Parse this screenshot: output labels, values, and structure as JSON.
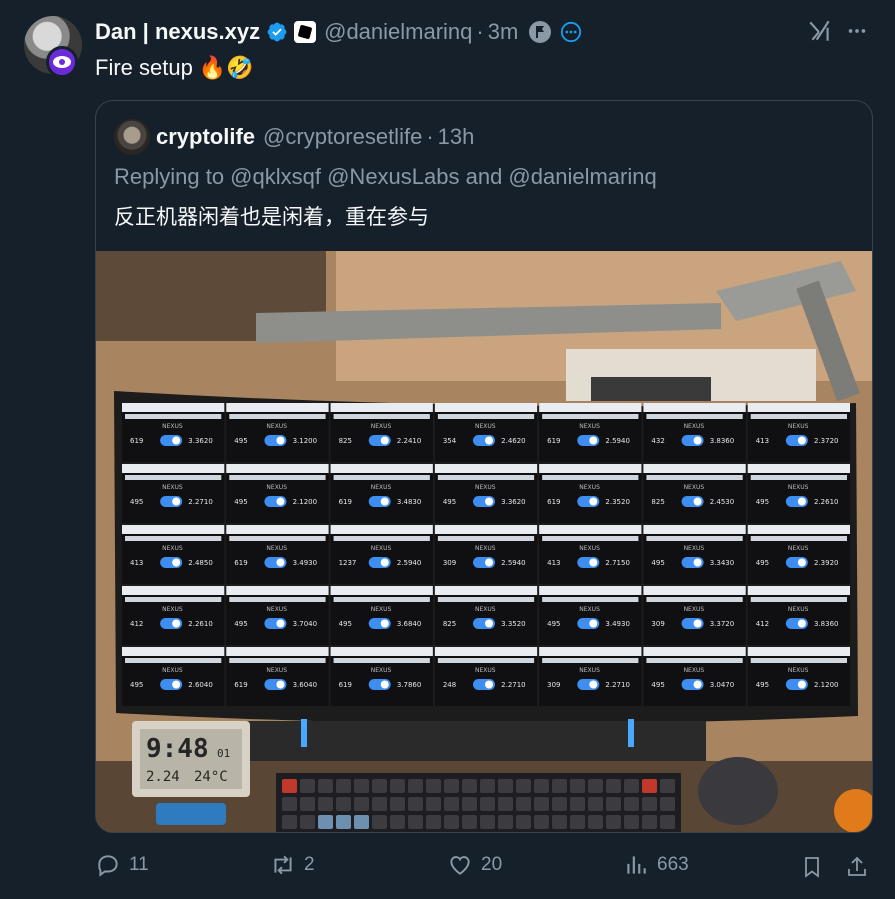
{
  "tweet": {
    "display_name": "Dan | nexus.xyz",
    "handle": "@danielmarinq",
    "separator": "·",
    "time": "3m",
    "text": "Fire setup 🔥🤣"
  },
  "quote": {
    "display_name": "cryptolife",
    "handle": "@cryptoresetlife",
    "separator": "·",
    "time": "13h",
    "reply_line": "Replying to @qklxsqf @NexusLabs and @danielmarinq",
    "text": "反正机器闲着也是闲着，重在参与",
    "media": {
      "monitor_rows": [
        [
          "619",
          "495",
          "825",
          "354",
          "619",
          "432",
          "413"
        ],
        [
          "495",
          "495",
          "619",
          "495",
          "619",
          "825",
          "495"
        ],
        [
          "413",
          "619",
          "1237",
          "309",
          "413",
          "495",
          "495"
        ],
        [
          "412",
          "495",
          "495",
          "825",
          "495",
          "309",
          "412"
        ],
        [
          "495",
          "619",
          "619",
          "248",
          "309",
          "495",
          "495"
        ]
      ],
      "monitor_values": [
        [
          "3.3620",
          "3.1200",
          "2.2410",
          "2.4620",
          "2.5940",
          "3.8360",
          "2.3720"
        ],
        [
          "2.2710",
          "2.1200",
          "3.4830",
          "3.3620",
          "2.3520",
          "2.4530",
          "2.2610"
        ],
        [
          "2.4850",
          "3.4930",
          "2.5940",
          "2.5940",
          "2.7150",
          "3.3430",
          "2.3920"
        ],
        [
          "2.2610",
          "3.7040",
          "3.6840",
          "3.3520",
          "3.4930",
          "3.3720",
          "3.8360"
        ],
        [
          "2.6040",
          "3.6040",
          "3.7860",
          "2.2710",
          "2.2710",
          "3.0470",
          "2.1200"
        ]
      ],
      "clock_time": "9:48",
      "clock_seconds": "01",
      "clock_date": "2.24",
      "clock_temp": "24°C",
      "brand_label": "NEXUS"
    }
  },
  "actions": {
    "replies": "11",
    "reposts": "2",
    "likes": "20",
    "views": "663"
  },
  "colors": {
    "background": "#15202b",
    "text": "#f7f9f9",
    "muted": "#8b98a5",
    "verified": "#1d9bf0",
    "border": "#38444d",
    "toggle_blue": "#3d8ef0"
  }
}
